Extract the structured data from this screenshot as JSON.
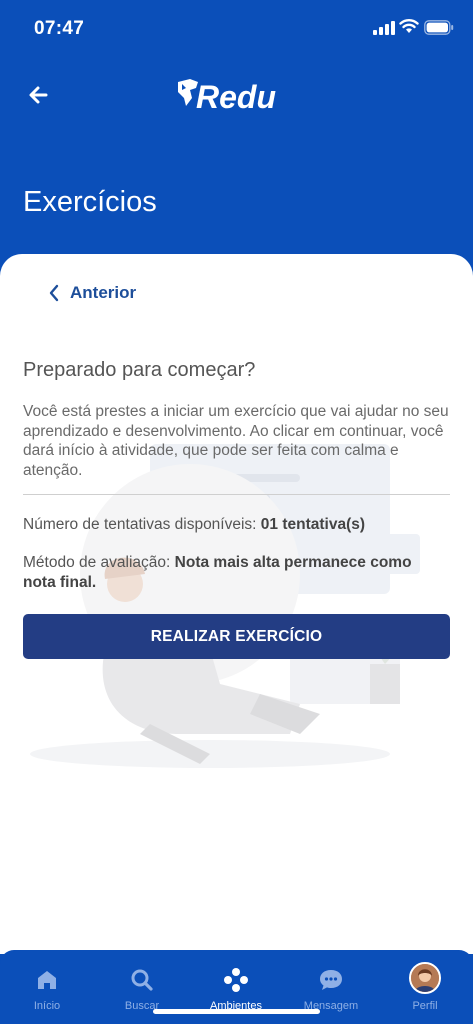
{
  "status_bar": {
    "time": "07:47"
  },
  "header": {
    "logo_text": "Redu",
    "title": "Exercícios"
  },
  "card": {
    "prev_label": "Anterior",
    "question_title": "Preparado para começar?",
    "description": "Você está prestes a iniciar um exercício que vai ajudar no seu aprendizado e desenvolvimento. Ao clicar em continuar, você dará início à atividade, que pode ser feita com calma e atenção.",
    "attempts_label": "Número de tentativas disponíveis: ",
    "attempts_value": "01 tentativa(s)",
    "method_label": "Método de avaliação: ",
    "method_value": "Nota mais alta permanece como nota final.",
    "cta_label": "REALIZAR EXERCÍCIO"
  },
  "bottom_nav": {
    "items": [
      {
        "label": "Início",
        "icon": "home-icon"
      },
      {
        "label": "Buscar",
        "icon": "search-icon"
      },
      {
        "label": "Ambientes",
        "icon": "environments-icon",
        "active": true
      },
      {
        "label": "Mensagem",
        "icon": "chat-icon"
      },
      {
        "label": "Perfil",
        "icon": "avatar"
      }
    ]
  },
  "colors": {
    "brand_blue": "#0b4fb9",
    "button_navy": "#233d84",
    "link_blue": "#1d4e9a"
  }
}
